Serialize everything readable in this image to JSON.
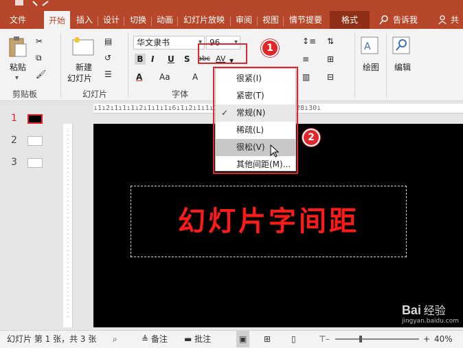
{
  "tabs": [
    {
      "label": "文件",
      "active": false
    },
    {
      "label": "开始",
      "active": true
    },
    {
      "label": "插入",
      "active": false
    },
    {
      "label": "设计",
      "active": false
    },
    {
      "label": "切换",
      "active": false
    },
    {
      "label": "动画",
      "active": false
    },
    {
      "label": "幻灯片放映",
      "active": false
    },
    {
      "label": "审阅",
      "active": false
    },
    {
      "label": "视图",
      "active": false
    },
    {
      "label": "情节提要",
      "active": false
    },
    {
      "label": "格式",
      "active": false
    }
  ],
  "tell_me": "告诉我",
  "share": "共",
  "ribbon": {
    "clipboard": {
      "label": "剪贴板",
      "paste": "粘贴"
    },
    "slides": {
      "label": "幻灯片",
      "new_slide_line1": "新建",
      "new_slide_line2": "幻灯片"
    },
    "font": {
      "label": "字体",
      "font_name": "华文隶书",
      "font_size": "96",
      "bold": "B",
      "italic": "I",
      "underline": "U",
      "shadow": "S",
      "strike": "abc",
      "spacing": "AV",
      "color": "A",
      "case": "Aa",
      "grow": "A"
    },
    "drawing": {
      "label": "绘图"
    },
    "editing": {
      "label": "编辑"
    }
  },
  "spacing_menu": {
    "items": [
      {
        "label": "很紧(I)",
        "state": "normal"
      },
      {
        "label": "紧密(T)",
        "state": "normal"
      },
      {
        "label": "常规(N)",
        "state": "checked"
      },
      {
        "label": "稀疏(L)",
        "state": "normal"
      },
      {
        "label": "很松(V)",
        "state": "highlighted"
      },
      {
        "label": "其他间距(M)...",
        "state": "normal"
      }
    ]
  },
  "markers": [
    "1",
    "2"
  ],
  "thumbnails": [
    {
      "num": "1"
    },
    {
      "num": "2"
    },
    {
      "num": "3"
    }
  ],
  "ruler_text": "ı1ı2ı1ı1ı1ı2ı1ı1ı1ı6ı1ı2ı1ı1ı1ı16ı18ı20ı22ı24ı26ı28ı30ı",
  "slide": {
    "text": "幻灯片字间距"
  },
  "status": {
    "slide_info": "幻灯片 第 1 张，共 3 张",
    "notes": "备注",
    "comments": "批注",
    "zoom": "40%",
    "zoom_level": 0.3
  },
  "watermark": {
    "brand": "Bai",
    "text": "经验",
    "url": "jingyan.baidu.com"
  },
  "colors": {
    "accent": "#b7472a",
    "highlight_red": "#e0262b",
    "slide_text": "#ff1a1a"
  }
}
